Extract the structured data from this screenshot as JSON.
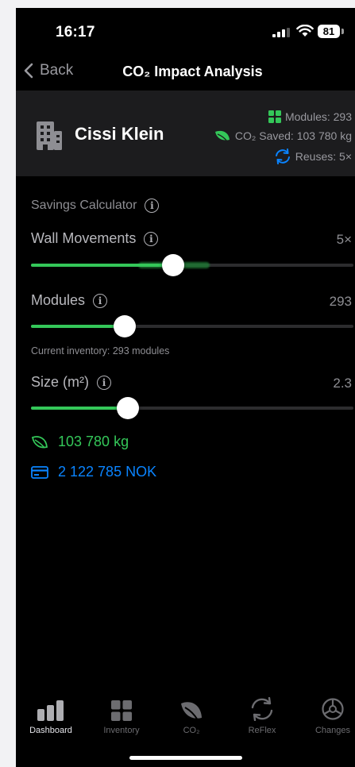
{
  "status_bar": {
    "time": "16:17",
    "battery": "81"
  },
  "nav": {
    "back_label": "Back",
    "title": "CO₂ Impact Analysis"
  },
  "client": {
    "name": "Cissi Klein",
    "modules_text": "Modules: 293",
    "co2_saved_text": "CO₂ Saved: 103 780 kg",
    "reuses_text": "Reuses: 5×"
  },
  "calculator": {
    "title": "Savings Calculator",
    "wall_movements": {
      "label": "Wall Movements",
      "value": "5×",
      "fill_percent": 44
    },
    "modules": {
      "label": "Modules",
      "value": "293",
      "fill_percent": 29,
      "hint": "Current inventory: 293 modules"
    },
    "size": {
      "label": "Size (m²)",
      "value": "2.3",
      "fill_percent": 30
    }
  },
  "results": {
    "co2": "103 780 kg",
    "cost": "2 122 785 NOK"
  },
  "tabs": [
    {
      "label": "Dashboard",
      "icon": "bar-chart-icon",
      "active": true
    },
    {
      "label": "Inventory",
      "icon": "grid-icon",
      "active": false
    },
    {
      "label": "CO₂",
      "icon": "leaf-icon",
      "active": false
    },
    {
      "label": "ReFlex",
      "icon": "refresh-icon",
      "active": false
    },
    {
      "label": "Changes",
      "icon": "steering-wheel-icon",
      "active": false
    }
  ],
  "colors": {
    "accent_green": "#34c759",
    "accent_blue": "#0a84ff",
    "card_bg": "#1c1c1e"
  }
}
